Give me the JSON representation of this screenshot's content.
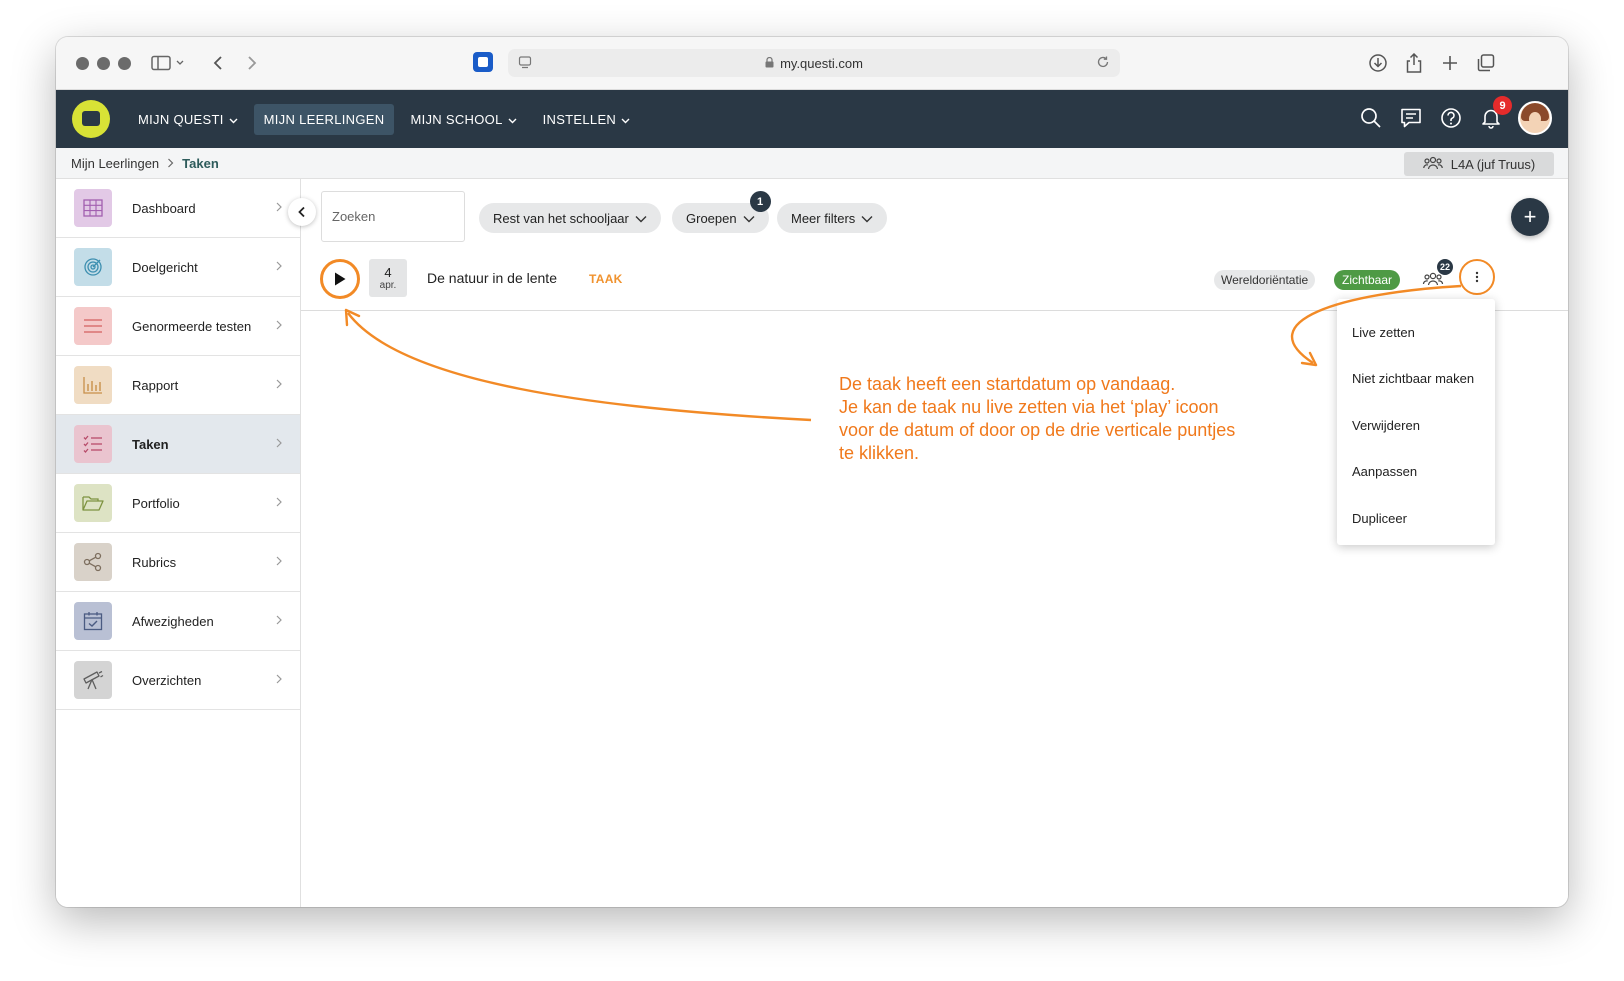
{
  "browser": {
    "url": "my.questi.com"
  },
  "nav": {
    "items": [
      {
        "label": "MIJN QUESTI",
        "dropdown": true,
        "active": false
      },
      {
        "label": "MIJN LEERLINGEN",
        "dropdown": false,
        "active": true
      },
      {
        "label": "MIJN SCHOOL",
        "dropdown": true,
        "active": false
      },
      {
        "label": "INSTELLEN",
        "dropdown": true,
        "active": false
      }
    ],
    "notification_count": "9"
  },
  "breadcrumb": {
    "parent": "Mijn Leerlingen",
    "current": "Taken"
  },
  "class_selector": {
    "label": "L4A (juf Truus)"
  },
  "sidebar": {
    "items": [
      {
        "label": "Dashboard",
        "icon": "grid-icon",
        "color": "#e2c9e6",
        "iconColor": "#a25fb0"
      },
      {
        "label": "Doelgericht",
        "icon": "target-icon",
        "color": "#c3dde8",
        "iconColor": "#3d8fb0"
      },
      {
        "label": "Genormeerde testen",
        "icon": "list-lines-icon",
        "color": "#f4c9c9",
        "iconColor": "#d46060"
      },
      {
        "label": "Rapport",
        "icon": "bar-chart-icon",
        "color": "#f0dcc3",
        "iconColor": "#c8904a"
      },
      {
        "label": "Taken",
        "icon": "checklist-icon",
        "color": "#eac4cf",
        "iconColor": "#b84d6b",
        "active": true
      },
      {
        "label": "Portfolio",
        "icon": "folder-icon",
        "color": "#dde3c4",
        "iconColor": "#7e9340"
      },
      {
        "label": "Rubrics",
        "icon": "share-nodes-icon",
        "color": "#d9d2c9",
        "iconColor": "#7d6e5e"
      },
      {
        "label": "Afwezigheden",
        "icon": "calendar-check-icon",
        "color": "#b9c0d4",
        "iconColor": "#4b5b82"
      },
      {
        "label": "Overzichten",
        "icon": "telescope-icon",
        "color": "#d4d4d4",
        "iconColor": "#5e5e5e"
      }
    ]
  },
  "toolbar": {
    "search_placeholder": "Zoeken",
    "filter_period": "Rest van het schooljaar",
    "filter_groups": "Groepen",
    "filter_groups_count": "1",
    "filter_more": "Meer filters",
    "add_label": "+"
  },
  "task": {
    "day": "4",
    "month": "apr.",
    "title": "De natuur in de lente",
    "type": "TAAK",
    "subject": "Wereldoriëntatie",
    "visibility": "Zichtbaar",
    "group_count": "22"
  },
  "menu": {
    "items": [
      "Live zetten",
      "Niet zichtbaar maken",
      "Verwijderen",
      "Aanpassen",
      "Dupliceer"
    ]
  },
  "annotation": {
    "lines": [
      "De taak heeft een startdatum op vandaag.",
      "Je kan de taak nu live zetten via het ‘play’ icoon",
      "voor de datum of door op de drie verticale puntjes",
      "te klikken."
    ]
  },
  "colors": {
    "nav_bg": "#2a3845",
    "accent_orange": "#f28a26",
    "visible_green": "#4e9a45",
    "logo_yellow": "#d8e236"
  }
}
